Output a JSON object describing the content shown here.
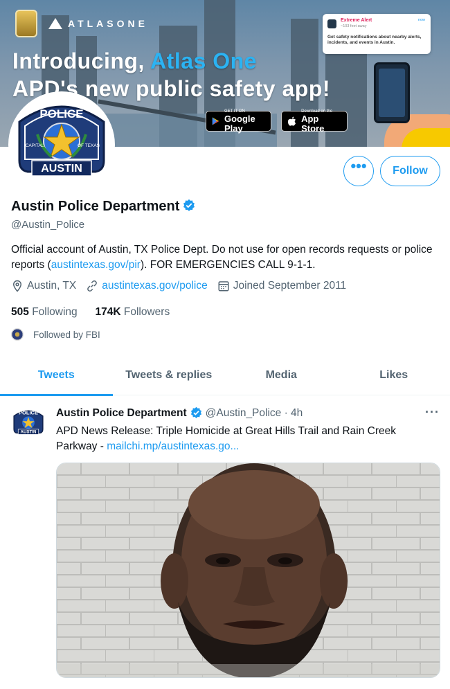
{
  "banner": {
    "brand": "ATLASONE",
    "headline_prefix": "Introducing, ",
    "headline_highlight": "Atlas One",
    "headline_line2": "APD's new public safety app!",
    "google_play_small": "GET IT ON",
    "google_play_large": "Google Play",
    "app_store_small": "Download on the",
    "app_store_large": "App Store",
    "alert_title": "Extreme Alert",
    "alert_distance": "~103 feet away",
    "alert_time": "now",
    "alert_body": "Get safety notifications about nearby alerts, incidents, and events in Austin."
  },
  "avatar": {
    "top_text": "POLICE",
    "left_text": "CAPITAL",
    "right_text": "OF TEXAS",
    "bottom_text": "AUSTIN"
  },
  "profile": {
    "name": "Austin Police Department",
    "handle": "@Austin_Police",
    "bio_part1": "Official account of Austin, TX Police Dept. Do not use for open records requests or police reports (",
    "bio_link": "austintexas.gov/pir",
    "bio_part2": "). FOR EMERGENCIES CALL 9-1-1.",
    "location": "Austin, TX",
    "website": "austintexas.gov/police",
    "joined": "Joined September 2011",
    "following_count": "505",
    "following_label": "Following",
    "followers_count": "174K",
    "followers_label": "Followers",
    "followed_by": "Followed by FBI",
    "more_label": "•••",
    "follow_label": "Follow"
  },
  "tabs": [
    "Tweets",
    "Tweets & replies",
    "Media",
    "Likes"
  ],
  "tweet": {
    "author": "Austin Police Department",
    "handle_time": "@Austin_Police · 4h",
    "text": "APD News Release: Triple Homicide at Great Hills Trail and Rain Creek Parkway - ",
    "link": "mailchi.mp/austintexas.go...",
    "more": "···"
  },
  "colors": {
    "accent": "#1d9bf0",
    "secondary_text": "#536471",
    "primary_text": "#0f1419"
  }
}
